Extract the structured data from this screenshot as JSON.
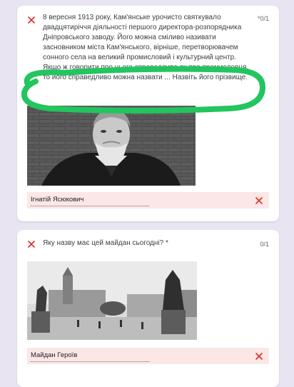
{
  "questions": [
    {
      "points": "*0/1",
      "text": "8 вересня 1913 року, Кам'янське урочисто святкувало двадцятиріччя діяльності першого директора-розпорядника Дніпровського заводу. Його   можна сміливо називати засновником міста Кам'янського, вірніше, перетворювачем сонного села на великий промисловий і культурний центр. Якщо ж говорити про нього справедливо як про промисловця, то його справедливо можна назвати ... Назвіть його прізвище.",
      "answer": "Ігнатій Ясюкович",
      "status": "incorrect"
    },
    {
      "points": "0/1",
      "text": "Яку назву має цей майдан сьогодні? *",
      "answer": "Майдан Героїв",
      "status": "incorrect"
    }
  ],
  "colors": {
    "incorrect": "#d93025",
    "answer_bg": "#fbe7e6",
    "highlight": "#22c55e",
    "page_bg": "#e9e4f2"
  }
}
